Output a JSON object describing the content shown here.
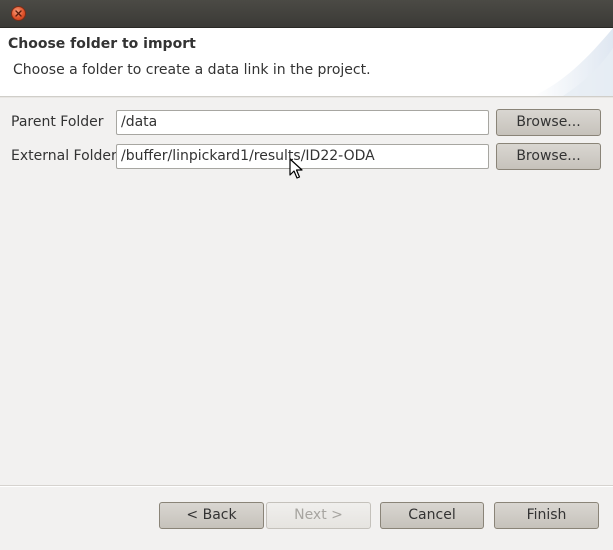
{
  "header": {
    "title": "Choose folder to import",
    "description": "Choose a folder to create a data link in the project."
  },
  "form": {
    "parent_folder": {
      "label": "Parent Folder",
      "value": "/data",
      "browse_label": "Browse..."
    },
    "external_folder": {
      "label": "External Folder",
      "value": "/buffer/linpickard1/results/ID22-ODA",
      "browse_label": "Browse..."
    }
  },
  "footer": {
    "back_label": "< Back",
    "next_label": "Next >",
    "cancel_label": "Cancel",
    "finish_label": "Finish"
  },
  "icons": {
    "close": "close-icon",
    "cursor": "mouse-pointer-icon"
  },
  "colors": {
    "titlebar": "#3b3a36",
    "close_button": "#e0532b",
    "window_background": "#f2f1f0",
    "header_background": "#ffffff",
    "button_background": "#c6c2bb"
  }
}
